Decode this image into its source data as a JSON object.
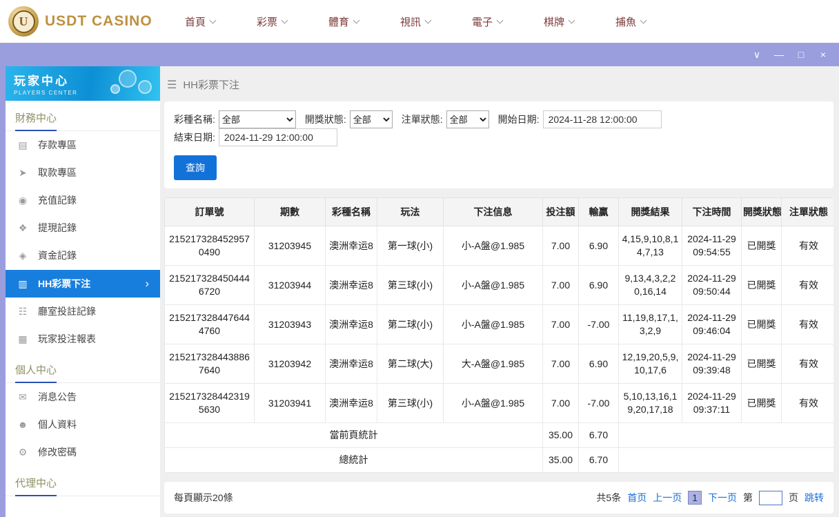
{
  "topnav": {
    "logo": {
      "badge": "U",
      "text": "USDT CASINO"
    },
    "items": [
      {
        "label": "首頁"
      },
      {
        "label": "彩票"
      },
      {
        "label": "體育"
      },
      {
        "label": "視訊"
      },
      {
        "label": "電子"
      },
      {
        "label": "棋牌"
      },
      {
        "label": "捕魚"
      }
    ]
  },
  "titlebar": {
    "controls": [
      {
        "name": "chevron-down-icon",
        "glyph": "∨"
      },
      {
        "name": "minimize-icon",
        "glyph": "—"
      },
      {
        "name": "maximize-icon",
        "glyph": "□"
      },
      {
        "name": "close-icon",
        "glyph": "×"
      }
    ]
  },
  "sidebar": {
    "title": "玩家中心",
    "subtitle": "PLAYERS CENTER",
    "sections": [
      {
        "title": "財務中心",
        "items": [
          {
            "label": "存款專區",
            "icon": "▤",
            "name": "deposit-area",
            "active": false
          },
          {
            "label": "取款專區",
            "icon": "➤",
            "name": "withdraw-area",
            "active": false
          },
          {
            "label": "充值記錄",
            "icon": "◉",
            "name": "recharge-records",
            "active": false
          },
          {
            "label": "提現記錄",
            "icon": "❖",
            "name": "withdrawal-records",
            "active": false
          },
          {
            "label": "資金記錄",
            "icon": "◈",
            "name": "fund-records",
            "active": false
          },
          {
            "label": "HH彩票下注",
            "icon": "▥",
            "name": "hh-lottery-bets",
            "active": true
          },
          {
            "label": "廳室投註記錄",
            "icon": "☷",
            "name": "room-bet-records",
            "active": false
          },
          {
            "label": "玩家投注報表",
            "icon": "▦",
            "name": "player-bet-report",
            "active": false
          }
        ]
      },
      {
        "title": "個人中心",
        "items": [
          {
            "label": "消息公告",
            "icon": "✉",
            "name": "announcements",
            "active": false
          },
          {
            "label": "個人資料",
            "icon": "☻",
            "name": "profile",
            "active": false
          },
          {
            "label": "修改密碼",
            "icon": "⚙",
            "name": "change-password",
            "active": false
          }
        ]
      },
      {
        "title": "代理中心",
        "items": []
      }
    ]
  },
  "page": {
    "header_icon": "☰",
    "title": "HH彩票下注"
  },
  "filters": {
    "lottery_name": {
      "label": "彩種名稱:",
      "value": "全部"
    },
    "draw_status": {
      "label": "開獎狀態:",
      "value": "全部"
    },
    "order_status": {
      "label": "注單狀態:",
      "value": "全部"
    },
    "start_date": {
      "label": "開始日期:",
      "value": "2024-11-28 12:00:00"
    },
    "end_date": {
      "label": "結束日期:",
      "value": "2024-11-29 12:00:00"
    },
    "search_label": "查詢"
  },
  "table": {
    "columns": [
      "訂單號",
      "期數",
      "彩種名稱",
      "玩法",
      "下注信息",
      "投注額",
      "輸贏",
      "開獎結果",
      "下注時間",
      "開獎狀態",
      "注單狀態"
    ],
    "rows": [
      [
        "2152173284529570490",
        "31203945",
        "澳洲幸运8",
        "第一球(小)",
        "小-A盤@1.985",
        "7.00",
        "6.90",
        "4,15,9,10,8,14,7,13",
        "2024-11-29 09:54:55",
        "已開獎",
        "有效"
      ],
      [
        "2152173284504446720",
        "31203944",
        "澳洲幸运8",
        "第三球(小)",
        "小-A盤@1.985",
        "7.00",
        "6.90",
        "9,13,4,3,2,20,16,14",
        "2024-11-29 09:50:44",
        "已開獎",
        "有效"
      ],
      [
        "2152173284476444760",
        "31203943",
        "澳洲幸运8",
        "第二球(小)",
        "小-A盤@1.985",
        "7.00",
        "-7.00",
        "11,19,8,17,1,3,2,9",
        "2024-11-29 09:46:04",
        "已開獎",
        "有效"
      ],
      [
        "2152173284438867640",
        "31203942",
        "澳洲幸运8",
        "第二球(大)",
        "大-A盤@1.985",
        "7.00",
        "6.90",
        "12,19,20,5,9,10,17,6",
        "2024-11-29 09:39:48",
        "已開獎",
        "有效"
      ],
      [
        "2152173284423195630",
        "31203941",
        "澳洲幸运8",
        "第三球(小)",
        "小-A盤@1.985",
        "7.00",
        "-7.00",
        "5,10,13,16,19,20,17,18",
        "2024-11-29 09:37:11",
        "已開獎",
        "有效"
      ]
    ],
    "summary": [
      {
        "label": "當前頁統計",
        "bet": "35.00",
        "winloss": "6.70"
      },
      {
        "label": "總統計",
        "bet": "35.00",
        "winloss": "6.70"
      }
    ]
  },
  "footer": {
    "page_size_text": "每頁顯示20條",
    "pagination": {
      "total": "共5条",
      "first": "首页",
      "prev": "上一页",
      "current": "1",
      "next": "下一页",
      "jump_prefix": "第",
      "jump_suffix": "页",
      "jump": "跳转",
      "jump_value": ""
    }
  },
  "colors": {
    "titlebar": "#9b9edd",
    "active_item_blue": "#187ede",
    "accent_blue": "#1372d8",
    "link_blue": "#1a6fd4",
    "gold": "#bd9140"
  }
}
